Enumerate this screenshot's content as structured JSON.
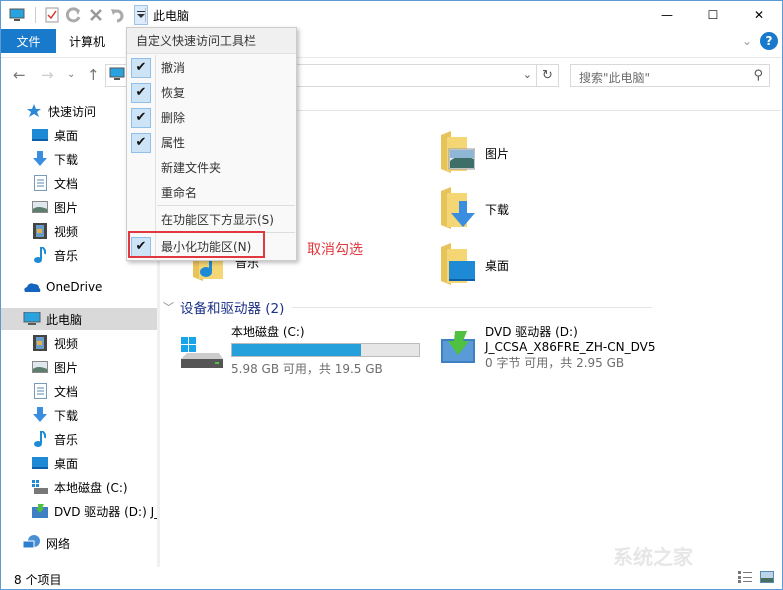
{
  "window": {
    "title": "此电脑",
    "controls": {
      "minimize": "—",
      "maximize": "☐",
      "close": "✕"
    }
  },
  "qat": {
    "icons": [
      "computer-icon",
      "properties-icon",
      "redo-icon",
      "delete-icon",
      "undo-icon",
      "customize-dropdown-icon"
    ]
  },
  "ribbon": {
    "tabs": [
      {
        "label": "文件",
        "active": true
      },
      {
        "label": "计算机",
        "active": false
      }
    ],
    "expand_icon": "⌄",
    "help_label": "?"
  },
  "nav": {
    "back": "←",
    "forward": "→",
    "recent": "⌄",
    "up": "↑",
    "address_chevron": "⌄",
    "refresh": "↻",
    "search_placeholder": "搜索\"此电脑\"",
    "search_icon": "⚲"
  },
  "sidebar": {
    "items": [
      {
        "label": "快速访问",
        "icon": "star-icon",
        "level": 1
      },
      {
        "label": "桌面",
        "icon": "desktop-icon",
        "level": 2
      },
      {
        "label": "下载",
        "icon": "download-icon",
        "level": 2
      },
      {
        "label": "文档",
        "icon": "document-icon",
        "level": 2
      },
      {
        "label": "图片",
        "icon": "picture-icon",
        "level": 2
      },
      {
        "label": "视频",
        "icon": "video-icon",
        "level": 2
      },
      {
        "label": "音乐",
        "icon": "music-icon",
        "level": 2
      },
      {
        "label": "OneDrive",
        "icon": "onedrive-icon",
        "level": 1
      },
      {
        "label": "此电脑",
        "icon": "computer-icon",
        "level": 1,
        "selected": true
      },
      {
        "label": "视频",
        "icon": "video-icon",
        "level": 2
      },
      {
        "label": "图片",
        "icon": "picture-icon",
        "level": 2
      },
      {
        "label": "文档",
        "icon": "document-icon",
        "level": 2
      },
      {
        "label": "下载",
        "icon": "download-icon",
        "level": 2
      },
      {
        "label": "音乐",
        "icon": "music-icon",
        "level": 2
      },
      {
        "label": "桌面",
        "icon": "desktop-icon",
        "level": 2
      },
      {
        "label": "本地磁盘 (C:)",
        "icon": "drive-icon",
        "level": 2
      },
      {
        "label": "DVD 驱动器 (D:) J_",
        "icon": "dvd-icon",
        "level": 2
      },
      {
        "label": "网络",
        "icon": "network-icon",
        "level": 1
      }
    ]
  },
  "content": {
    "folders": [
      {
        "label": "音乐",
        "icon": "music-folder-icon"
      },
      {
        "label": "图片",
        "icon": "picture-folder-icon"
      },
      {
        "label": "下载",
        "icon": "download-folder-icon"
      },
      {
        "label": "桌面",
        "icon": "desktop-folder-icon"
      }
    ],
    "devices_header": "设备和驱动器 (2)",
    "drives": [
      {
        "name": "本地磁盘 (C:)",
        "info": "5.98 GB 可用，共 19.5 GB",
        "used_fraction": 0.69
      },
      {
        "name": "DVD 驱动器 (D:)",
        "sub": "J_CCSA_X86FRE_ZH-CN_DV5",
        "info": "0 字节 可用，共 2.95 GB"
      }
    ]
  },
  "status": {
    "count": "8 个项目"
  },
  "menu": {
    "header": "自定义快速访问工具栏",
    "items": [
      {
        "label": "撤消",
        "checked": true
      },
      {
        "label": "恢复",
        "checked": true
      },
      {
        "label": "删除",
        "checked": true
      },
      {
        "label": "属性",
        "checked": true
      },
      {
        "label": "新建文件夹",
        "checked": false
      },
      {
        "label": "重命名",
        "checked": false
      },
      {
        "label": "在功能区下方显示(S)",
        "checked": false,
        "mnemonic": "S"
      },
      {
        "label": "最小化功能区(N)",
        "checked": true,
        "mnemonic": "N"
      }
    ],
    "check_glyph": "✔"
  },
  "annotation": {
    "text": "取消勾选",
    "color": "#e0383e"
  },
  "watermark": "系统之家",
  "colors": {
    "accent": "#1979ca",
    "bar_fill": "#26a0da",
    "highlight": "#e0383e"
  }
}
